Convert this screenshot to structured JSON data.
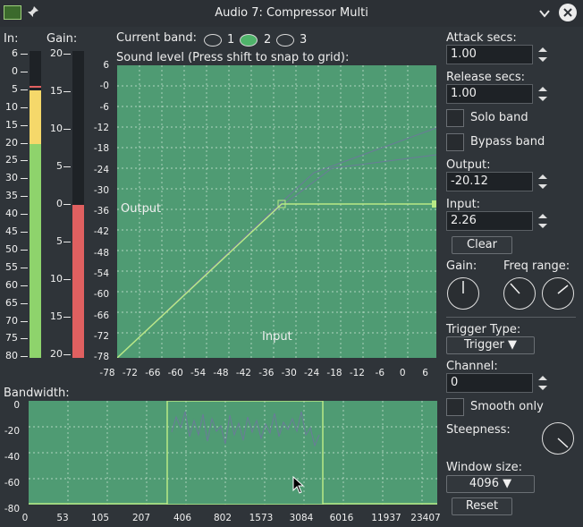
{
  "window": {
    "title": "Audio 7: Compressor Multi"
  },
  "meters": {
    "in_label": "In:",
    "gain_label": "Gain:",
    "in_ticks": [
      "6",
      "0",
      "5",
      "10",
      "15",
      "20",
      "25",
      "30",
      "35",
      "40",
      "45",
      "50",
      "55",
      "60",
      "65",
      "70",
      "75",
      "80"
    ],
    "gain_ticks": [
      "20",
      "15",
      "10",
      "5",
      "0",
      "5",
      "10",
      "15",
      "20"
    ]
  },
  "band": {
    "label": "Current band:",
    "options": [
      "1",
      "2",
      "3"
    ],
    "selected": "2"
  },
  "graph": {
    "title": "Sound level (Press shift to snap to grid):",
    "output_label": "Output",
    "input_label": "Input",
    "y_ticks": [
      "6",
      "-0",
      "-6",
      "-12",
      "-18",
      "-24",
      "-30",
      "-36",
      "-42",
      "-48",
      "-54",
      "-60",
      "-66",
      "-72",
      "-78"
    ],
    "x_ticks": [
      "-78",
      "-72",
      "-66",
      "-60",
      "-54",
      "-48",
      "-42",
      "-36",
      "-30",
      "-24",
      "-18",
      "-12",
      "-6",
      "0",
      "6"
    ]
  },
  "bandwidth": {
    "label": "Bandwidth:",
    "y_ticks": [
      "0",
      "-20",
      "-40",
      "-60",
      "-80"
    ],
    "x_ticks": [
      "0",
      "53",
      "105",
      "207",
      "406",
      "802",
      "1573",
      "3084",
      "6016",
      "11937",
      "23407"
    ]
  },
  "controls": {
    "attack_label": "Attack secs:",
    "attack_value": "1.00",
    "release_label": "Release secs:",
    "release_value": "1.00",
    "solo_label": "Solo band",
    "bypass_label": "Bypass band",
    "output_label": "Output:",
    "output_value": "-20.12",
    "input_label": "Input:",
    "input_value": "2.26",
    "clear_label": "Clear",
    "gain_label": "Gain:",
    "freq_label": "Freq range:",
    "trigger_type_label": "Trigger Type:",
    "trigger_value": "Trigger",
    "channel_label": "Channel:",
    "channel_value": "0",
    "smooth_label": "Smooth only",
    "steepness_label": "Steepness:",
    "window_label": "Window size:",
    "window_value": "4096",
    "reset_label": "Reset"
  },
  "colors": {
    "graph_bg": "#4f9b73",
    "curve": "#b8e986",
    "meter_green": "#8ed36c",
    "meter_yellow": "#f5d86a",
    "meter_red": "#e06060",
    "meter_bg": "#1e2226"
  },
  "icons": {
    "app": "cinelerra-icon",
    "pin": "pin-icon",
    "collapse": "chevron-down-icon",
    "close": "close-icon"
  }
}
